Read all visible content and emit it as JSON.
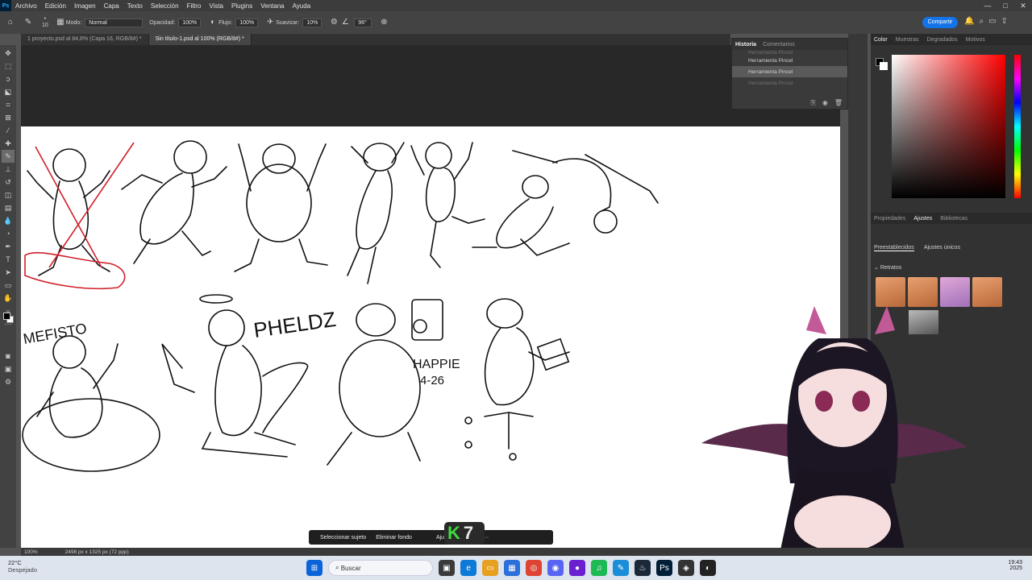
{
  "app": {
    "logo": "Ps"
  },
  "menu": [
    "Archivo",
    "Edición",
    "Imagen",
    "Capa",
    "Texto",
    "Selección",
    "Filtro",
    "Vista",
    "Plugins",
    "Ventana",
    "Ayuda"
  ],
  "window_controls": [
    "—",
    "□",
    "✕"
  ],
  "options": {
    "brush_size": "10",
    "mode_label": "Modo:",
    "mode_value": "Normal",
    "opacity_label": "Opacidad:",
    "opacity_value": "100%",
    "flow_label": "Flujo:",
    "flow_value": "100%",
    "smoothing_label": "Suavizar:",
    "smoothing_value": "10%",
    "angle_value": "96°",
    "share_label": "Compartir"
  },
  "tabs": [
    "1 proyecto.psd al 84,8% (Capa 16, RGB/8#) *",
    "Sin título-1.psd al 100% (RGB/8#) *"
  ],
  "history": {
    "tabs": [
      "Historia",
      "Comentarios"
    ],
    "items": [
      "Herramienta Pincel",
      "Herramienta Pincel",
      "Herramienta Pincel",
      "Herramienta Pincel"
    ]
  },
  "color_panel": {
    "tabs": [
      "Color",
      "Muestras",
      "Degradados",
      "Motivos"
    ]
  },
  "adjust_panel": {
    "tabs": [
      "Propiedades",
      "Ajustes",
      "Bibliotecas"
    ],
    "subtabs": [
      "Preestablecidos",
      "Ajustes únicos"
    ],
    "group": "Retratos"
  },
  "canvas": {
    "labels": [
      "MEFISTO",
      "PHELDZ",
      "HAPPIE",
      "4-26"
    ]
  },
  "context_bar": {
    "buttons": [
      "Seleccionar sujeto",
      "Eliminar fondo",
      "Ajustar colores"
    ]
  },
  "badge": {
    "k": "K",
    "n": "7"
  },
  "status": {
    "zoom": "100%",
    "dims": "2498 px x 1325 px (72 ppp)"
  },
  "taskbar": {
    "temp": "22°C",
    "weather": "Despejado",
    "search": "Buscar",
    "time": "19:43",
    "date": "2025"
  },
  "colors": {
    "accent": "#1473e6",
    "workspace": "#282828",
    "panel": "#323232",
    "red_stroke": "#d0202a"
  }
}
